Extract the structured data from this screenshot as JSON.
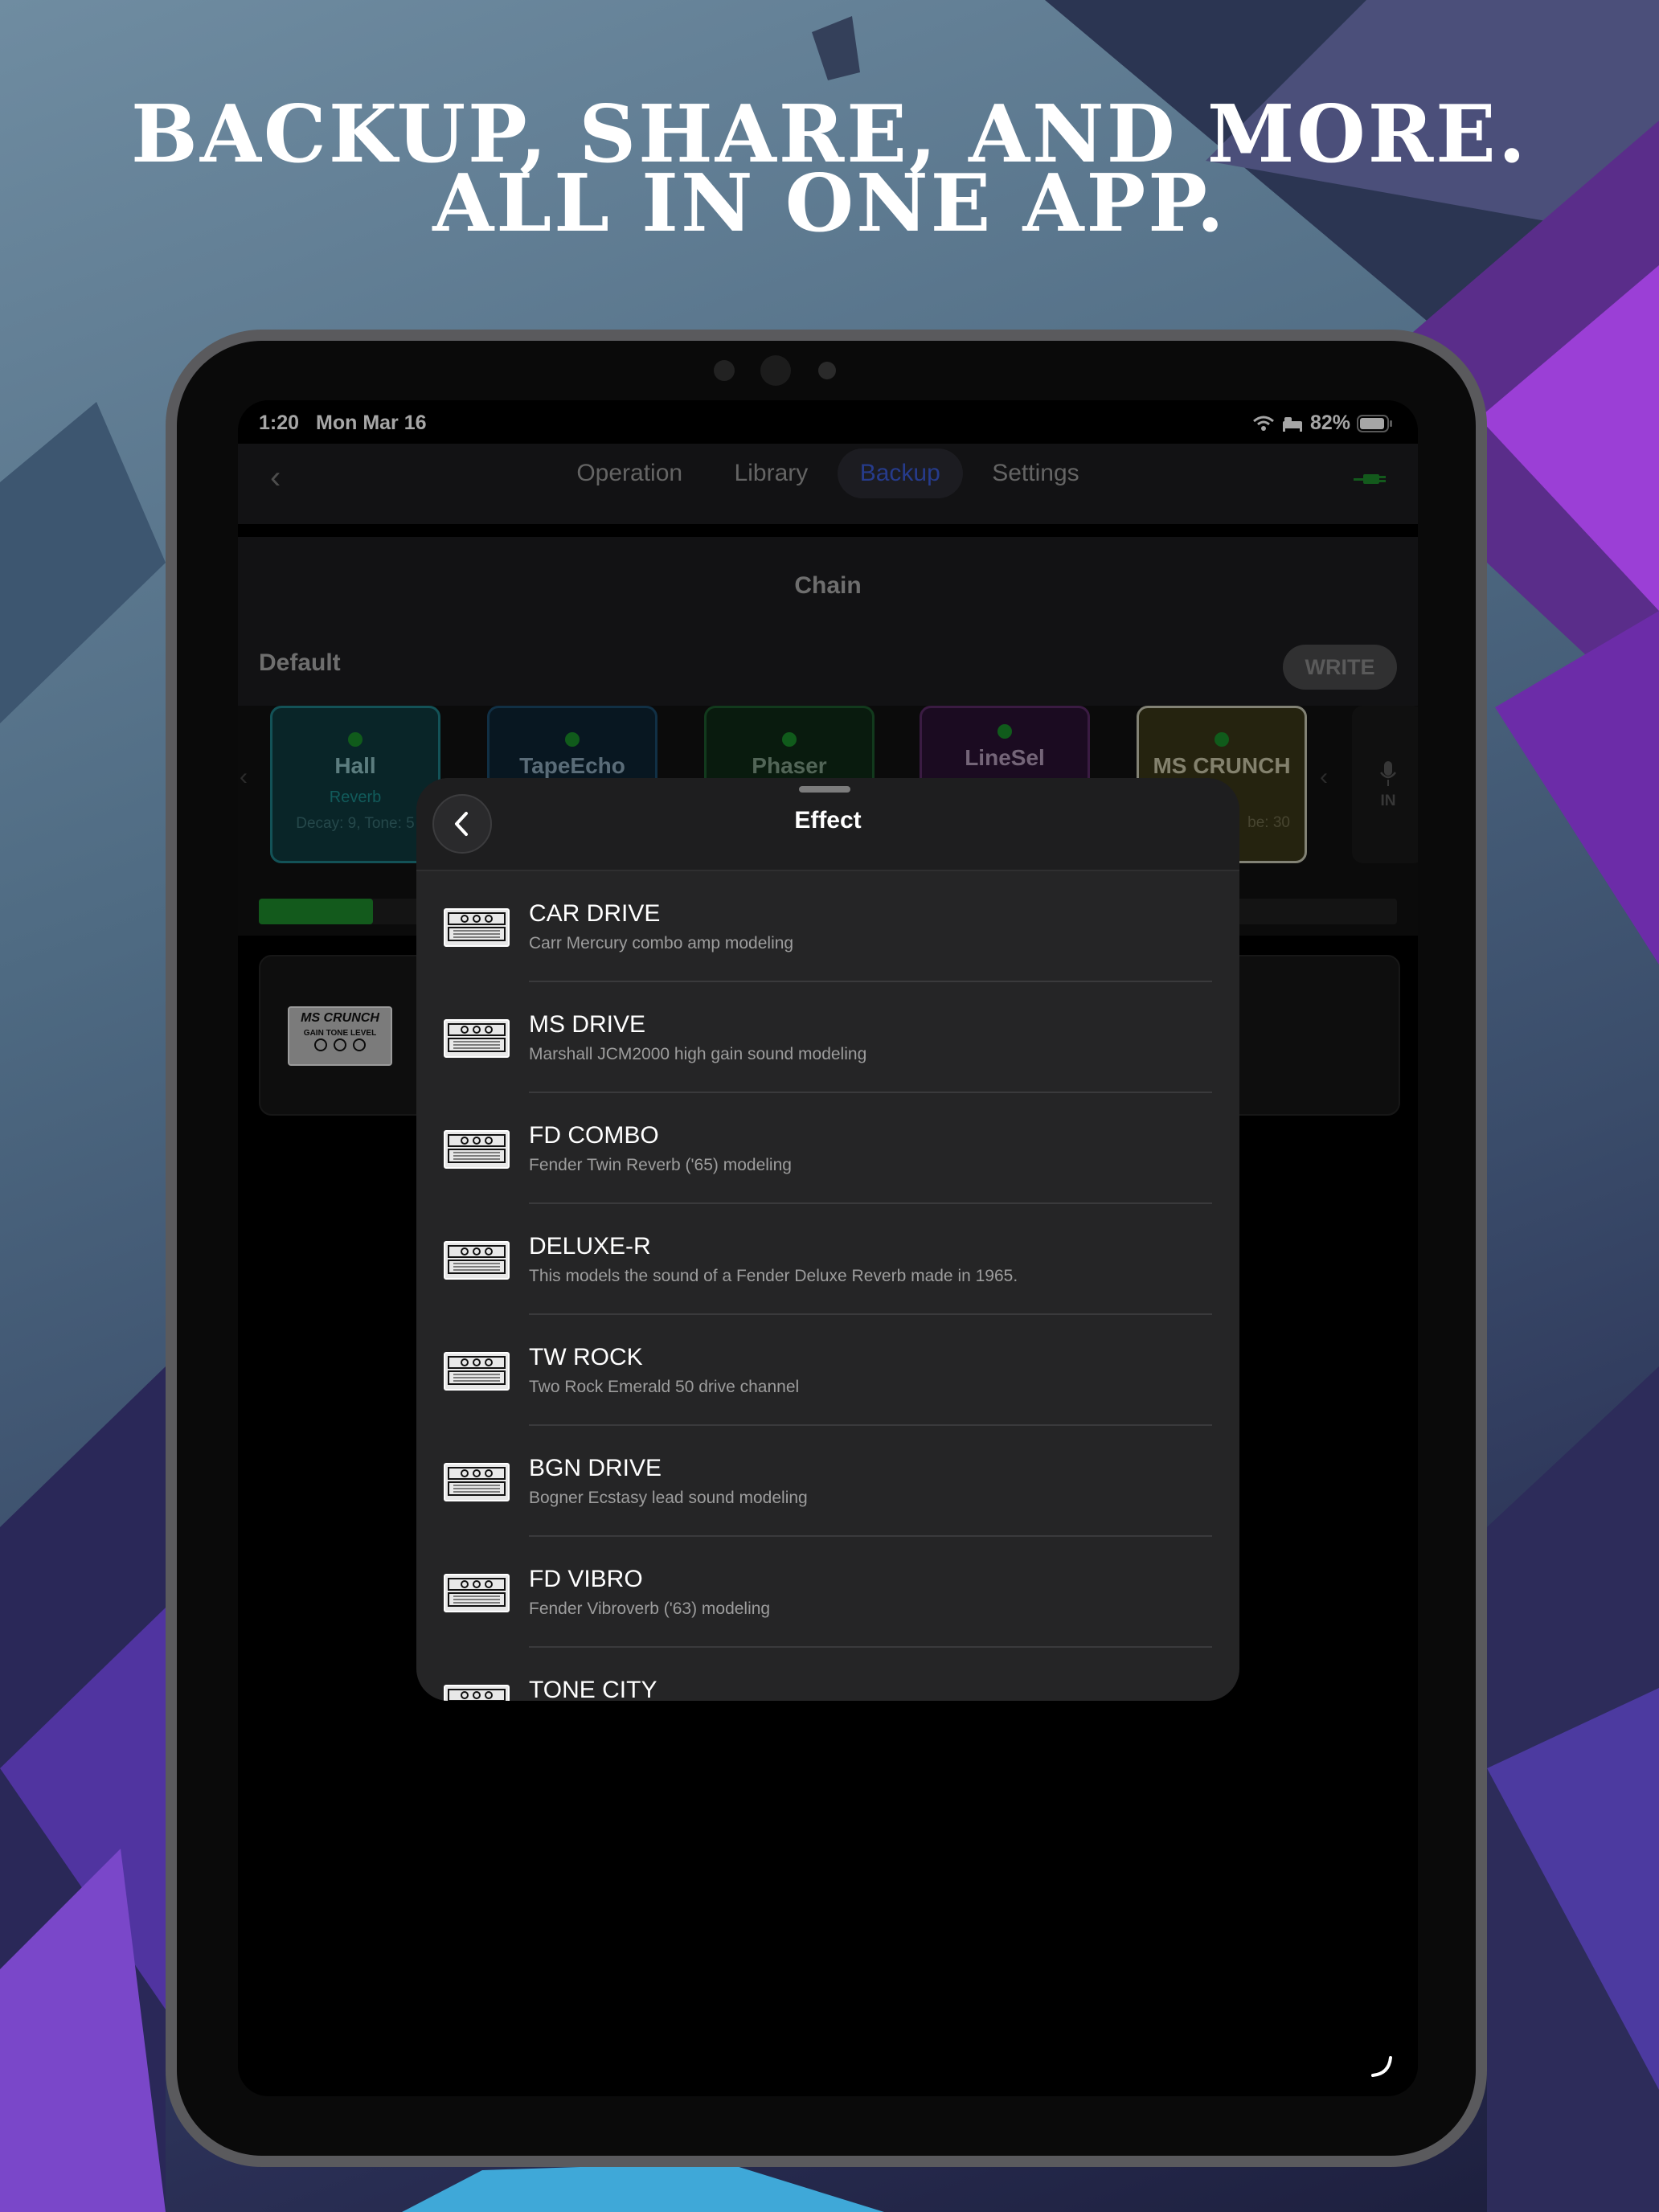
{
  "headline": {
    "line1": "BACKUP, SHARE, AND MORE.",
    "line2": "ALL IN ONE APP."
  },
  "status_bar": {
    "time": "1:20",
    "date": "Mon Mar 16",
    "battery": "82%"
  },
  "nav": {
    "tabs": [
      {
        "label": "Operation",
        "active": false
      },
      {
        "label": "Library",
        "active": false
      },
      {
        "label": "Backup",
        "active": true
      },
      {
        "label": "Settings",
        "active": false
      }
    ]
  },
  "chain": {
    "title": "Chain",
    "preset_name": "Default",
    "write_label": "WRITE",
    "progress": 0.1
  },
  "slots": [
    {
      "name": "Hall",
      "type": "Reverb",
      "params": "Decay: 9, Tone: 5"
    },
    {
      "name": "TapeEcho",
      "type": "",
      "params": ""
    },
    {
      "name": "Phaser",
      "type": "",
      "params": ""
    },
    {
      "name": "LineSel",
      "type": "",
      "params": ""
    },
    {
      "name": "MS CRUNCH",
      "type": "",
      "params": "be: 30"
    },
    {
      "name": "IN",
      "type": "",
      "params": ""
    }
  ],
  "detail": {
    "pedal_label": "MS CRUNCH",
    "knobs": "GAIN TONE LEVEL"
  },
  "sheet": {
    "title": "Effect",
    "items": [
      {
        "title": "CAR DRIVE",
        "desc": "Carr Mercury combo amp modeling",
        "icon": "amp-pedal-icon"
      },
      {
        "title": "MS DRIVE",
        "desc": "Marshall JCM2000 high gain sound modeling",
        "icon": "amp-pedal-icon"
      },
      {
        "title": "FD COMBO",
        "desc": "Fender Twin Reverb ('65) modeling",
        "icon": "amp-pedal-icon"
      },
      {
        "title": "DELUXE-R",
        "desc": "This models the sound of a Fender Deluxe Reverb made in 1965.",
        "icon": "amp-pedal-icon"
      },
      {
        "title": "TW ROCK",
        "desc": "Two Rock Emerald 50 drive channel",
        "icon": "amp-pedal-icon"
      },
      {
        "title": "BGN DRIVE",
        "desc": "Bogner Ecstasy lead sound modeling",
        "icon": "amp-pedal-icon"
      },
      {
        "title": "FD VIBRO",
        "desc": "Fender Vibroverb ('63) modeling",
        "icon": "amp-pedal-icon"
      },
      {
        "title": "TONE CITY",
        "desc": "",
        "icon": "amp-pedal-icon"
      }
    ]
  },
  "colors": {
    "accent": "#3b5bd6",
    "green": "#1e8a2c",
    "sheet_bg": "#252526"
  }
}
